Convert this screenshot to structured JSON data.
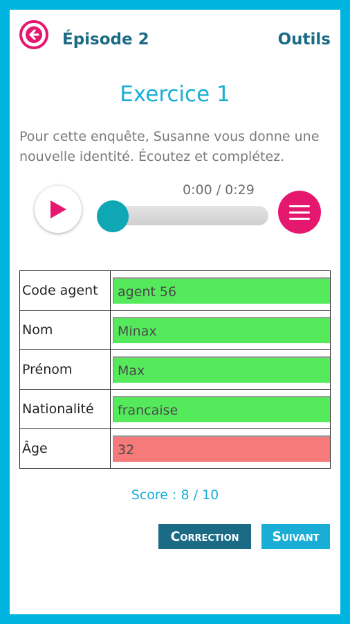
{
  "header": {
    "back_icon": "arrow-left-icon",
    "title": "Épisode 2",
    "tools_label": "Outils"
  },
  "exercise": {
    "title": "Exercice 1",
    "instructions": "Pour cette enquête, Susanne vous donne une nouvelle identité. Écoutez et complétez."
  },
  "player": {
    "time": "0:00 / 0:29",
    "progress": 0,
    "play_icon": "play-icon",
    "menu_icon": "hamburger-menu-icon"
  },
  "form": {
    "rows": [
      {
        "label": "Code agent",
        "value": "agent 56",
        "status": "correct"
      },
      {
        "label": "Nom",
        "value": "Minax",
        "status": "correct"
      },
      {
        "label": "Prénom",
        "value": "Max",
        "status": "correct"
      },
      {
        "label": "Nationalité",
        "value": "francaise",
        "status": "correct"
      },
      {
        "label": "Âge",
        "value": "32",
        "status": "incorrect"
      }
    ]
  },
  "score": "Score : 8 / 10",
  "buttons": {
    "correction": "Correction",
    "next": "Suivant"
  },
  "colors": {
    "frame": "#00b4e0",
    "accent_pink": "#e5176f",
    "title_dark": "#1b6b86",
    "title_light": "#1aaed6",
    "correct": "#55ea5c",
    "incorrect": "#f57a79"
  }
}
